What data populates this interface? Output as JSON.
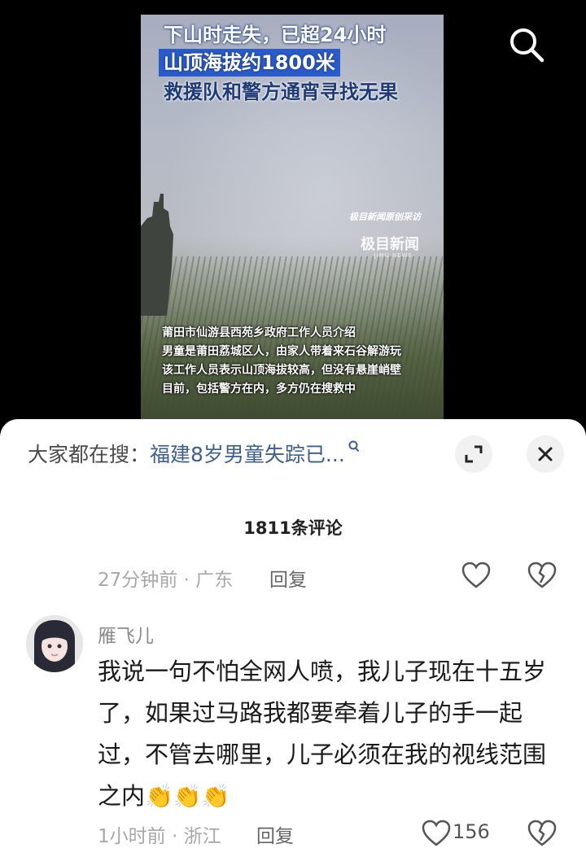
{
  "video": {
    "headline": [
      "下山时走失，已超24小时",
      "山顶海拔约1800米",
      "救援队和警方通宵寻找无果"
    ],
    "watermark": {
      "line1": "极目新闻原创采访",
      "line2": "极目新闻",
      "line3": "JIMU NEWS"
    },
    "subtitles": [
      "莆田市仙游县西苑乡政府工作人员介绍",
      "男童是莆田荔城区人，由家人带着来石谷解游玩",
      "该工作人员表示山顶海拔较高，但没有悬崖峭壁",
      "目前，包括警方在内，多方仍在搜救中"
    ]
  },
  "suggestion": {
    "label": "大家都在搜：",
    "query": "福建8岁男童失踪已..."
  },
  "comment_count": "1811条评论",
  "prev_comment": {
    "time_location": "27分钟前 · 广东",
    "reply": "回复"
  },
  "comment": {
    "username": "雁飞儿",
    "text": "我说一句不怕全网人喷，我儿子现在十五岁了，如果过马路我都要牵着儿子的手一起过，不管去哪里，儿子必须在我的视线范围之内",
    "emojis": "👏👏👏",
    "time_location": "1小时前 · 浙江",
    "reply": "回复",
    "likes": "156"
  },
  "colors": {
    "link": "#3b5e93",
    "headline_bg": "#2a5bc8",
    "sheet_bg": "#ffffff"
  }
}
